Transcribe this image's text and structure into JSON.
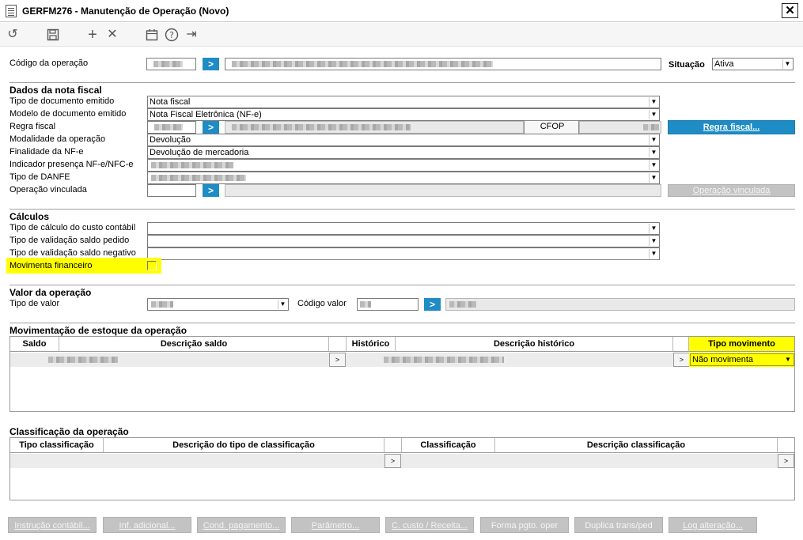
{
  "window": {
    "title": "GERFM276 - Manutenção de Operação (Novo)",
    "close_glyph": "✕"
  },
  "toolbar": {
    "undo_icon": "↺",
    "save_icon": "💾",
    "add_icon": "+",
    "remove_icon": "✕",
    "calendar_icon": "📅",
    "help_icon": "?",
    "exit_icon": "⇥"
  },
  "header": {
    "codigo_label": "Código da operação",
    "situacao_label": "Situação",
    "situacao_value": "Ativa",
    "go_glyph": ">"
  },
  "nota_fiscal": {
    "section_title": "Dados da nota fiscal",
    "tipo_documento_label": "Tipo de documento emitido",
    "tipo_documento_value": "Nota fiscal",
    "modelo_documento_label": "Modelo de documento emitido",
    "modelo_documento_value": "Nota Fiscal Eletrônica (NF-e)",
    "regra_fiscal_label": "Regra fiscal",
    "cfop_button": "CFOP",
    "regra_fiscal_button": "Regra fiscal...",
    "modalidade_label": "Modalidade da operação",
    "modalidade_value": "Devolução",
    "finalidade_label": "Finalidade da NF-e",
    "finalidade_value": "Devolução de mercadoria",
    "indicador_label": "Indicador presença NF-e/NFC-e",
    "tipo_danfe_label": "Tipo de DANFE",
    "operacao_vinculada_label": "Operação vinculada",
    "operacao_vinculada_button": "Operação vinculada"
  },
  "calculos": {
    "section_title": "Cálculos",
    "custo_label": "Tipo de cálculo do custo contábil",
    "saldo_pedido_label": "Tipo de validação saldo pedido",
    "saldo_negativo_label": "Tipo de validação saldo negativo",
    "movimenta_label": "Movimenta financeiro"
  },
  "valor": {
    "section_title": "Valor da operação",
    "tipo_valor_label": "Tipo de valor",
    "codigo_valor_label": "Código valor"
  },
  "estoque": {
    "section_title": "Movimentação de estoque da operação",
    "columns": [
      "Saldo",
      "Descrição saldo",
      "Histórico",
      "Descrição histórico",
      "Tipo movimento"
    ],
    "row_tipo_movimento": "Não movimenta",
    "row_button_glyph": ">"
  },
  "classificacao": {
    "section_title": "Classificação da operação",
    "columns": [
      "Tipo classificação",
      "Descrição do tipo de classificação",
      "Classificação",
      "Descrição classificação"
    ],
    "row_button_glyph": ">"
  },
  "footer_buttons": [
    "Instrução contábil...",
    "Inf. adicional...",
    "Cond. pagamento...",
    "Parâmetro...",
    "C. custo / Receita...",
    "Forma pgto. oper",
    "Duplica trans/ped",
    "Log alteração..."
  ],
  "colors": {
    "accent": "#1e8cc5",
    "highlight": "#ffff00",
    "disabled": "#c3c3c3"
  }
}
